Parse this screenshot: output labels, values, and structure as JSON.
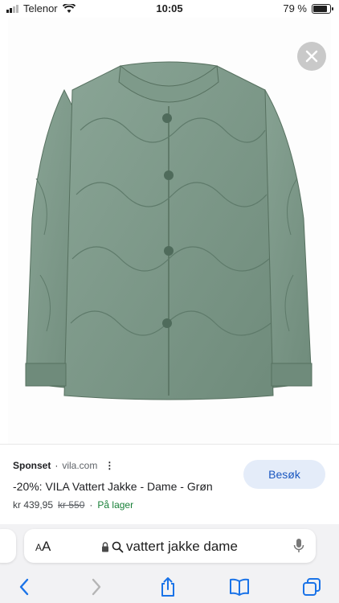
{
  "status_bar": {
    "carrier": "Telenor",
    "time": "10:05",
    "battery": "79 %",
    "battery_level": 0.79
  },
  "product_image": {
    "close_icon": "close-icon"
  },
  "ad": {
    "sponsored_label": "Sponset",
    "separator": "·",
    "domain": "vila.com",
    "title": "-20%: VILA Vattert Jakke - Dame - Grøn",
    "price": "kr 439,95",
    "old_price": "kr 550",
    "availability": "På lager",
    "visit_button": "Besøk"
  },
  "browser": {
    "aa_label": "AA",
    "query": "vattert jakke dame",
    "toolbar_icons": [
      "back-icon",
      "forward-icon",
      "share-icon",
      "bookmarks-icon",
      "tabs-icon"
    ]
  },
  "colors": {
    "jacket_green": "#7e9a8a",
    "accent_blue": "#1a57c0",
    "stock_green": "#188038"
  }
}
